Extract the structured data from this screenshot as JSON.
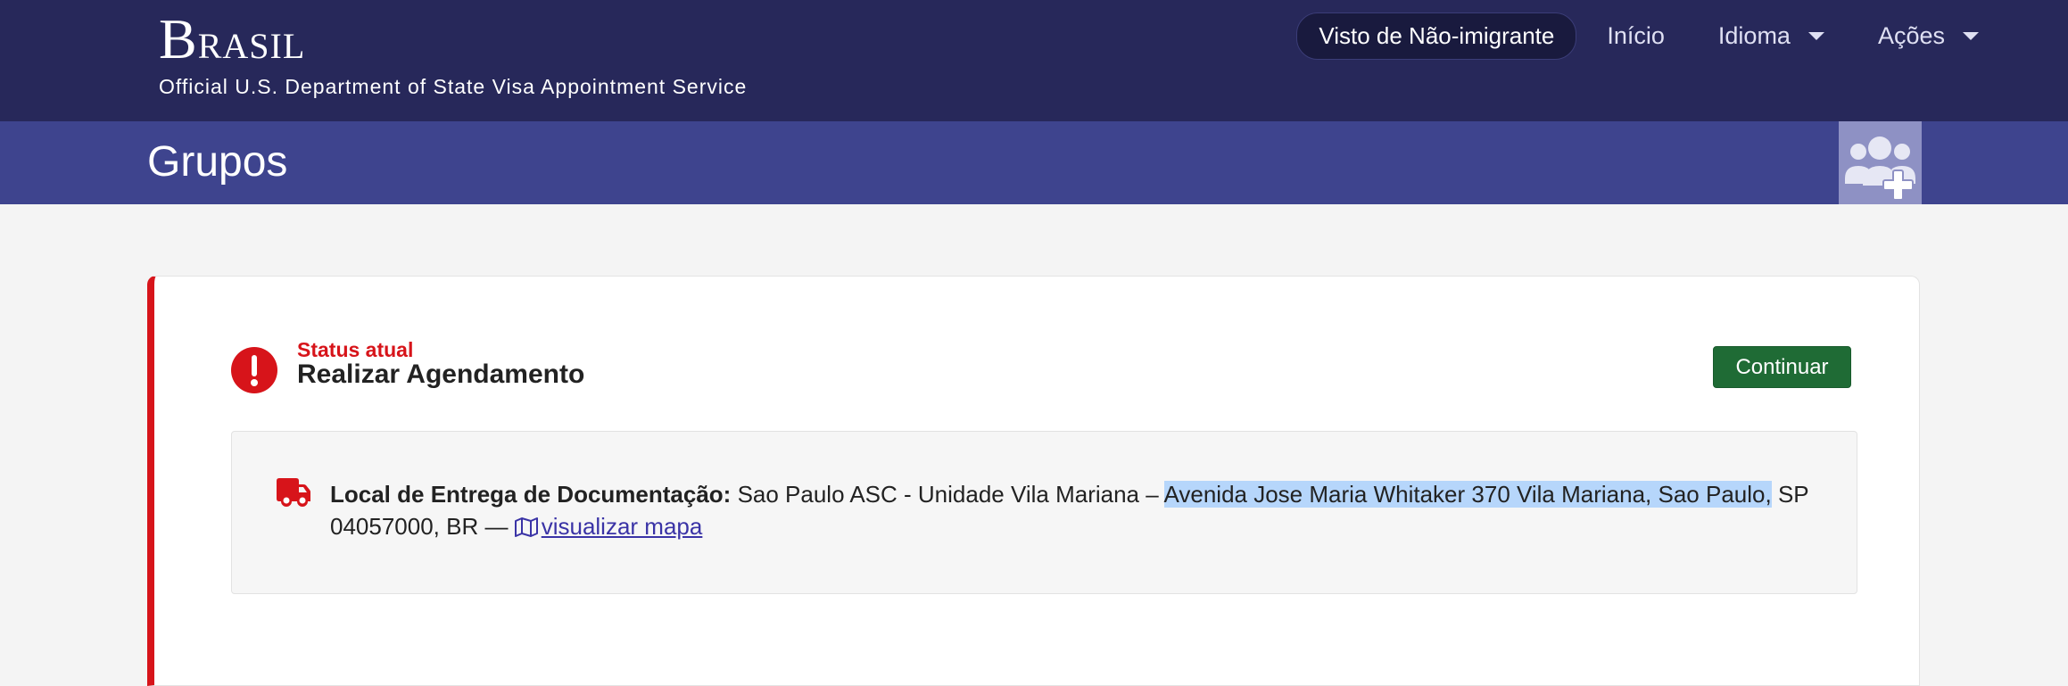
{
  "brand": {
    "title_first": "B",
    "title_rest": "RASIL",
    "subtitle": "Official U.S. Department of State Visa Appointment Service"
  },
  "nav": {
    "pill": "Visto de Não-imigrante",
    "home": "Início",
    "language": "Idioma",
    "actions": "Ações"
  },
  "subheader": {
    "title": "Grupos",
    "group_add_icon": "users-plus-icon"
  },
  "status": {
    "label": "Status atual",
    "value": "Realizar Agendamento",
    "continue_button": "Continuar",
    "icon": "exclamation-circle-icon"
  },
  "delivery": {
    "icon": "truck-icon",
    "label": "Local de Entrega de Documentação:",
    "location_prefix": "Sao Paulo ASC - Unidade Vila Mariana –",
    "address_highlighted": "Avenida Jose Maria Whitaker 370 Vila Mariana, Sao Paulo,",
    "address_rest": "SP 04057000, BR —",
    "map_link": "visualizar mapa",
    "map_icon": "map-icon"
  },
  "colors": {
    "navbar": "#27285a",
    "subbar": "#3e448e",
    "accent_red": "#d7141a",
    "button_green": "#1f6b35",
    "link": "#3a33a6",
    "selection": "#b6d6fb"
  }
}
